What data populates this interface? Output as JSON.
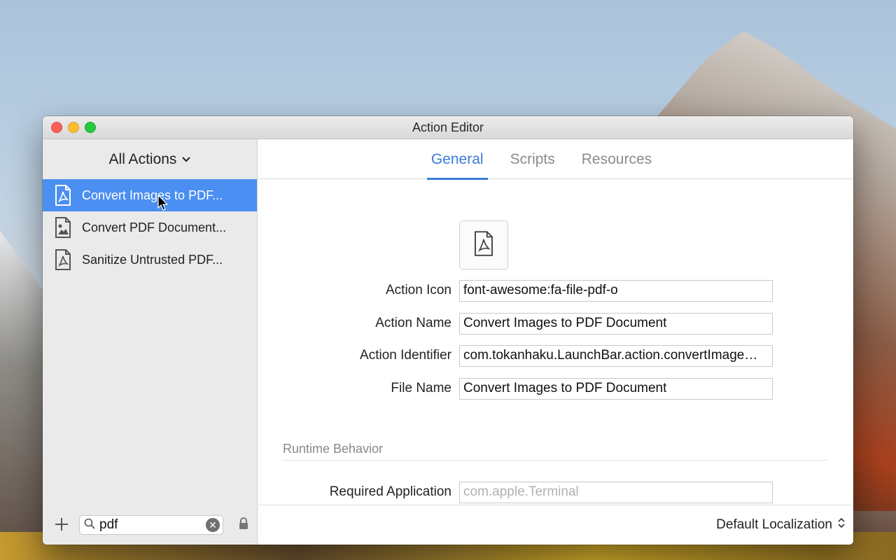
{
  "window": {
    "title": "Action Editor"
  },
  "sidebar": {
    "header_label": "All Actions",
    "items": [
      {
        "label": "Convert Images to PDF...",
        "icon": "file-pdf-icon",
        "selected": true
      },
      {
        "label": "Convert PDF Document...",
        "icon": "file-image-icon",
        "selected": false
      },
      {
        "label": "Sanitize Untrusted PDF...",
        "icon": "file-pdf-icon",
        "selected": false
      }
    ],
    "search": {
      "value": "pdf"
    }
  },
  "tabs": [
    {
      "label": "General",
      "active": true
    },
    {
      "label": "Scripts",
      "active": false
    },
    {
      "label": "Resources",
      "active": false
    }
  ],
  "general": {
    "fields": [
      {
        "label": "Action Icon",
        "value": "font-awesome:fa-file-pdf-o"
      },
      {
        "label": "Action Name",
        "value": "Convert Images to PDF Document"
      },
      {
        "label": "Action Identifier",
        "value": "com.tokanhaku.LaunchBar.action.convertImage…"
      },
      {
        "label": "File Name",
        "value": "Convert Images to PDF Document"
      }
    ],
    "runtime_section_title": "Runtime Behavior",
    "required_application": {
      "label": "Required Application",
      "placeholder": "com.apple.Terminal"
    }
  },
  "footer": {
    "localization": "Default Localization"
  },
  "colors": {
    "accent": "#3b7bd9",
    "selection": "#4a8ff1"
  }
}
